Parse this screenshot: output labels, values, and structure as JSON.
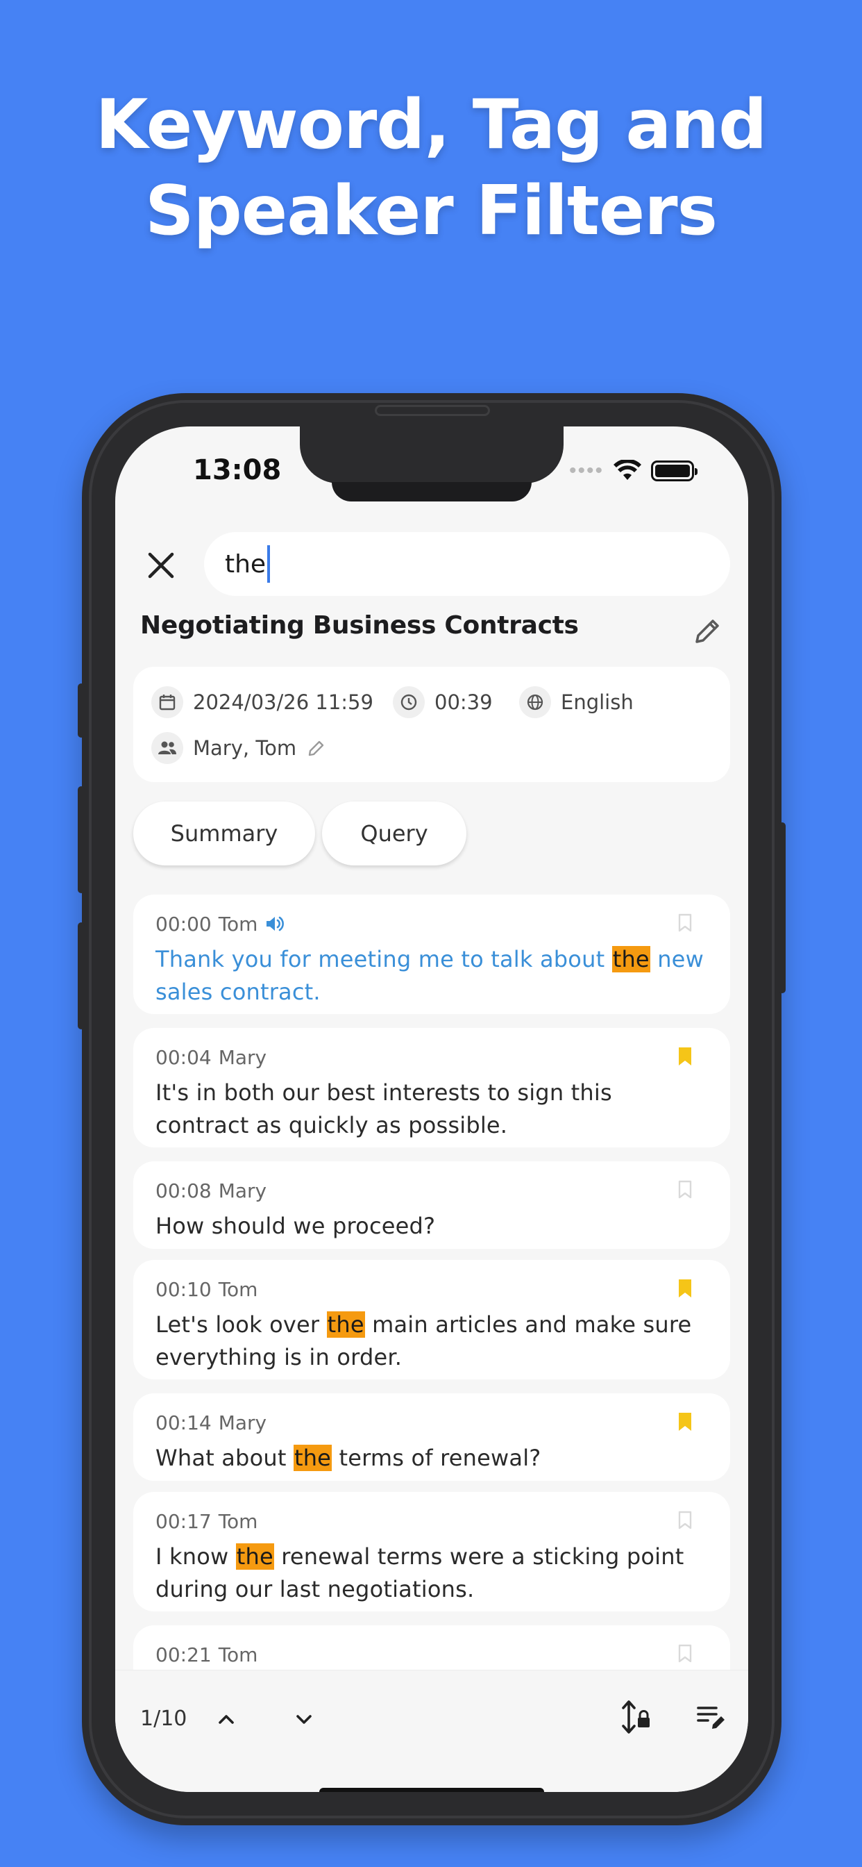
{
  "headline": {
    "line1": "Keyword, Tag and",
    "line2": "Speaker Filters"
  },
  "status": {
    "time": "13:08"
  },
  "search": {
    "value": "the"
  },
  "recording": {
    "title": "Negotiating Business Contracts",
    "date": "2024/03/26 11:59",
    "duration": "00:39",
    "language": "English",
    "speakers": "Mary, Tom"
  },
  "tabs": {
    "summary": "Summary",
    "query": "Query"
  },
  "transcript": [
    {
      "time": "00:00",
      "speaker": "Tom",
      "pre": "Thank you for meeting me to talk about ",
      "match": "the",
      "post": " new sales contract.",
      "bookmarked": false,
      "playing": true
    },
    {
      "time": "00:04",
      "speaker": "Mary",
      "pre": "It's in both our best interests to sign this contract as quickly as possible.",
      "match": "",
      "post": "",
      "bookmarked": true,
      "playing": false
    },
    {
      "time": "00:08",
      "speaker": "Mary",
      "pre": "How should we proceed?",
      "match": "",
      "post": "",
      "bookmarked": false,
      "playing": false
    },
    {
      "time": "00:10",
      "speaker": "Tom",
      "pre": "Let's look over ",
      "match": "the",
      "post": " main articles and make sure everything is in order.",
      "bookmarked": true,
      "playing": false
    },
    {
      "time": "00:14",
      "speaker": "Mary",
      "pre": "What about ",
      "match": "the",
      "post": " terms of renewal?",
      "bookmarked": true,
      "playing": false
    },
    {
      "time": "00:17",
      "speaker": "Tom",
      "pre": "I know ",
      "match": "the",
      "post": " renewal terms were a sticking point during our last negotiations.",
      "bookmarked": false,
      "playing": false
    },
    {
      "time": "00:21",
      "speaker": "Tom",
      "pre": "",
      "match": "",
      "post": "",
      "bookmarked": false,
      "playing": false
    }
  ],
  "pager": {
    "position": "1/10"
  },
  "colors": {
    "background": "#4682f4",
    "highlight": "#f59a10",
    "active_text": "#3a8fd8",
    "bookmark_on": "#f5c518",
    "bookmark_off": "#d9d9d9"
  }
}
